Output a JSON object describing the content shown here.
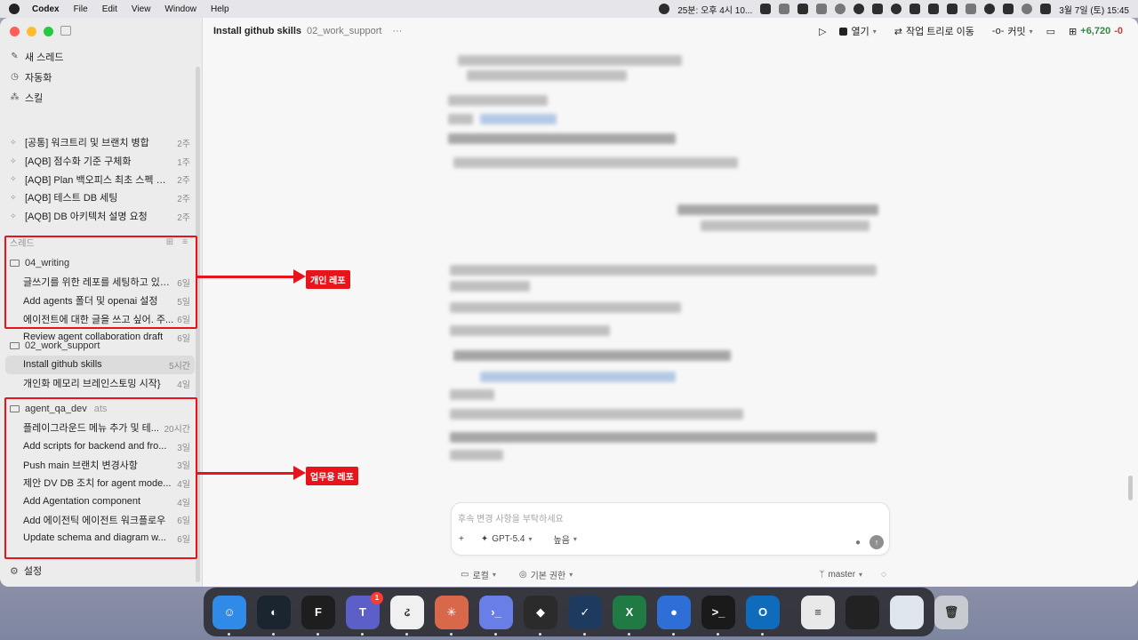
{
  "menubar": {
    "app_name": "Codex",
    "menus": [
      "File",
      "Edit",
      "View",
      "Window",
      "Help"
    ],
    "timer_text": "25분: 오후 4시 10...",
    "datetime": "3월 7일 (토) 15:45"
  },
  "sidebar": {
    "nav": [
      {
        "label": "새 스레드",
        "icon": "new-thread-icon"
      },
      {
        "label": "자동화",
        "icon": "clock-icon"
      },
      {
        "label": "스킬",
        "icon": "skills-icon"
      }
    ],
    "pinned": [
      {
        "title": "[공통] 워크트리 및 브랜치 병합",
        "age": "2주"
      },
      {
        "title": "[AQB] 점수화 기준 구체화",
        "age": "1주"
      },
      {
        "title": "[AQB] Plan 백오피스 최초 스펙 정의",
        "age": "2주"
      },
      {
        "title": "[AQB] 테스트 DB 세팅",
        "age": "2주"
      },
      {
        "title": "[AQB] DB 아키텍처 설명 요청",
        "age": "2주"
      }
    ],
    "threads_header": "스레드",
    "groups": [
      {
        "name": "04_writing",
        "extra": "",
        "threads": [
          {
            "title": "글쓰기를 위한 레포를 세팅하고 있어...",
            "age": "6일"
          },
          {
            "title": "Add agents 폴더 및 openai 설정",
            "age": "5일"
          },
          {
            "title": "에이전트에 대한 글을 쓰고 싶어. 주...",
            "age": "6일"
          },
          {
            "title": "Review agent collaboration draft",
            "age": "6일"
          }
        ]
      },
      {
        "name": "02_work_support",
        "extra": "",
        "threads": [
          {
            "title": "Install github skills",
            "age": "5시간"
          },
          {
            "title": "개인화 메모리 브레인스토밍 시작}",
            "age": "4일"
          }
        ]
      },
      {
        "name": "agent_qa_dev",
        "extra": "ats",
        "threads": [
          {
            "title": "플레이그라운드 메뉴 추가 및 테...",
            "age": "20시간"
          },
          {
            "title": "Add scripts for backend and fro...",
            "age": "3일"
          },
          {
            "title": "Push main 브랜치 변경사항",
            "age": "3일"
          },
          {
            "title": "제안 DV DB 조치 for agent mode...",
            "age": "4일"
          },
          {
            "title": "Add Agentation component",
            "age": "4일"
          },
          {
            "title": "Add 에이전틱 에이전트 워크플로우",
            "age": "6일"
          },
          {
            "title": "Update schema and diagram w...",
            "age": "6일"
          }
        ]
      }
    ],
    "settings_label": "설정"
  },
  "annotations": {
    "personal_repo": "개인 레포",
    "work_repo": "업무용 레포"
  },
  "topbar": {
    "title": "Install github skills",
    "project": "02_work_support",
    "more": "···",
    "open_label": "열기",
    "worktree_label": "작업 트리로 이동",
    "commit_label": "커밋",
    "diff_added": "+6,720",
    "diff_removed": "-0"
  },
  "composer": {
    "placeholder": "후속 변경 사항을 부탁하세요",
    "add": "+",
    "model": "GPT-5.4",
    "reasoning": "높음"
  },
  "footer": {
    "env": "로컬",
    "permission": "기본 권한",
    "branch": "master"
  },
  "dock": {
    "apps": [
      {
        "name": "finder",
        "glyph": "☺",
        "color": "#2f8ae8",
        "running": true
      },
      {
        "name": "codex",
        "glyph": "◐",
        "color": "#1b2530",
        "running": true
      },
      {
        "name": "figma",
        "glyph": "F",
        "color": "#1e1e1e",
        "running": true
      },
      {
        "name": "teams",
        "glyph": "T",
        "color": "#5b5fc7",
        "running": true,
        "badge": "1"
      },
      {
        "name": "app-5",
        "glyph": "ઢ",
        "color": "#f0f0f0",
        "running": true
      },
      {
        "name": "claude",
        "glyph": "✳",
        "color": "#d9674a",
        "running": true
      },
      {
        "name": "app-7",
        "glyph": "›_",
        "color": "#6a7ee8",
        "running": true
      },
      {
        "name": "app-8",
        "glyph": "◆",
        "color": "#2b2b2b",
        "running": true
      },
      {
        "name": "app-9",
        "glyph": "✓",
        "color": "#1f3a5f",
        "running": true
      },
      {
        "name": "excel",
        "glyph": "X",
        "color": "#1f7a44",
        "running": true
      },
      {
        "name": "app-11",
        "glyph": "●",
        "color": "#2d6fd6",
        "running": true
      },
      {
        "name": "terminal",
        "glyph": ">_",
        "color": "#1a1a1a",
        "running": true
      },
      {
        "name": "outlook",
        "glyph": "O",
        "color": "#0f6cbd",
        "running": true
      },
      {
        "name": "document",
        "glyph": "≡",
        "color": "#e9e9e9",
        "running": false
      },
      {
        "name": "window-preview-1",
        "glyph": "",
        "color": "#222222",
        "running": false
      },
      {
        "name": "window-preview-2",
        "glyph": "",
        "color": "#dfe6ee",
        "running": false
      },
      {
        "name": "trash",
        "glyph": "🗑",
        "color": "#c8ccd2",
        "running": false
      }
    ]
  }
}
